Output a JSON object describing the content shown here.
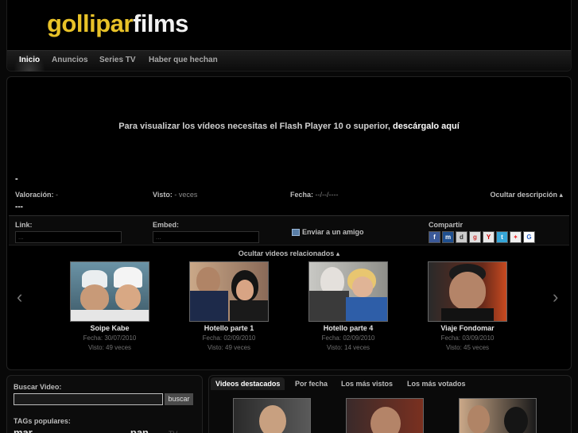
{
  "header": {
    "logo_part1": "golliparfilms",
    "nav": [
      "Inicio",
      "Anuncios",
      "Series TV",
      "Haber que hechan"
    ]
  },
  "player": {
    "flash_message": "Para visualizar los vídeos necesitas el Flash Player 10 o superior,",
    "flash_link": "descárgalo aquí",
    "title": "-",
    "rating_label": "Valoración:",
    "rating_value": "-",
    "views_label": "Visto:",
    "views_value": "- veces",
    "date_label": "Fecha:",
    "date_value": "--/--/----",
    "hide_description": "Ocultar descripción ▴",
    "description": "---",
    "link_label": "Link:",
    "link_value": "...",
    "embed_label": "Embed:",
    "embed_value": "...",
    "send_friend": "Enviar a un amigo",
    "share_label": "Compartir",
    "share_icons": [
      "facebook-icon",
      "myspace-icon",
      "delicious-icon",
      "google-reader-icon",
      "yahoo-icon",
      "twitter-icon",
      "windows-live-icon",
      "google-icon"
    ]
  },
  "related": {
    "toggle": "Ocultar videos relacionados ▴",
    "videos": [
      {
        "title": "Soipe Kabe",
        "date": "Fecha: 30/07/2010",
        "views": "Visto: 49 veces"
      },
      {
        "title": "Hotello parte 1",
        "date": "Fecha: 02/09/2010",
        "views": "Visto: 49 veces"
      },
      {
        "title": "Hotello parte 4",
        "date": "Fecha: 02/09/2010",
        "views": "Visto: 14 veces"
      },
      {
        "title": "Viaje Fondomar",
        "date": "Fecha: 03/09/2010",
        "views": "Visto: 45 veces"
      }
    ]
  },
  "search": {
    "label": "Buscar Video:",
    "button": "buscar",
    "tags_label": "TAGs populares:",
    "tags_big1": "mar",
    "tags_big2": "pan",
    "tags_small": "TV"
  },
  "featured": {
    "tabs": [
      "Videos destacados",
      "Por fecha",
      "Los más vistos",
      "Los más votados"
    ]
  }
}
